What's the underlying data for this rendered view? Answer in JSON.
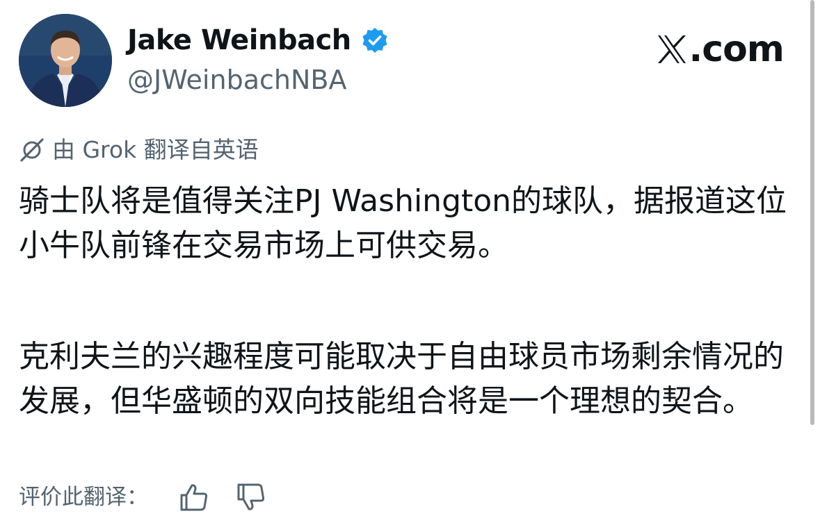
{
  "author": {
    "display_name": "Jake Weinbach",
    "handle": "@JWeinbachNBA",
    "verified": true
  },
  "site": {
    "logo_text": ".com",
    "logo_icon": "x-logo-icon"
  },
  "translation": {
    "note": "由 Grok 翻译自英语",
    "icon": "grok-icon"
  },
  "tweet": {
    "paragraphs": [
      "骑士队将是值得关注PJ Washington的球队，据报道这位小牛队前锋在交易市场上可供交易。",
      "克利夫兰的兴趣程度可能取决于自由球员市场剩余情况的发展，但华盛顿的双向技能组合将是一个理想的契合。"
    ]
  },
  "rating": {
    "label": "评价此翻译：",
    "thumbs_up_icon": "thumbs-up-icon",
    "thumbs_down_icon": "thumbs-down-icon"
  },
  "colors": {
    "text_primary": "#0f1419",
    "text_secondary": "#536471",
    "verified_blue": "#1d9bf0"
  }
}
